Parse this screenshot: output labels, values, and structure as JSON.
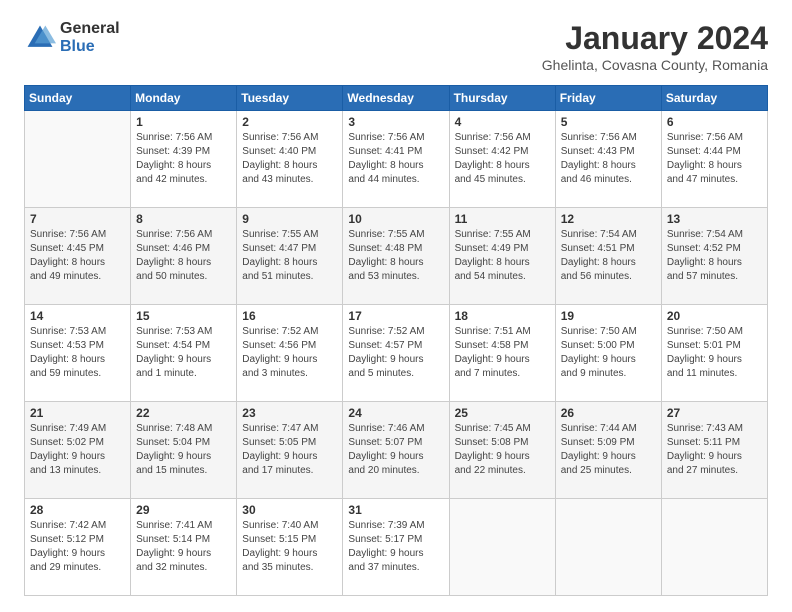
{
  "header": {
    "logo": {
      "general": "General",
      "blue": "Blue"
    },
    "title": "January 2024",
    "subtitle": "Ghelinta, Covasna County, Romania"
  },
  "weekdays": [
    "Sunday",
    "Monday",
    "Tuesday",
    "Wednesday",
    "Thursday",
    "Friday",
    "Saturday"
  ],
  "weeks": [
    [
      {
        "day": "",
        "info": ""
      },
      {
        "day": "1",
        "info": "Sunrise: 7:56 AM\nSunset: 4:39 PM\nDaylight: 8 hours\nand 42 minutes."
      },
      {
        "day": "2",
        "info": "Sunrise: 7:56 AM\nSunset: 4:40 PM\nDaylight: 8 hours\nand 43 minutes."
      },
      {
        "day": "3",
        "info": "Sunrise: 7:56 AM\nSunset: 4:41 PM\nDaylight: 8 hours\nand 44 minutes."
      },
      {
        "day": "4",
        "info": "Sunrise: 7:56 AM\nSunset: 4:42 PM\nDaylight: 8 hours\nand 45 minutes."
      },
      {
        "day": "5",
        "info": "Sunrise: 7:56 AM\nSunset: 4:43 PM\nDaylight: 8 hours\nand 46 minutes."
      },
      {
        "day": "6",
        "info": "Sunrise: 7:56 AM\nSunset: 4:44 PM\nDaylight: 8 hours\nand 47 minutes."
      }
    ],
    [
      {
        "day": "7",
        "info": "Sunrise: 7:56 AM\nSunset: 4:45 PM\nDaylight: 8 hours\nand 49 minutes."
      },
      {
        "day": "8",
        "info": "Sunrise: 7:56 AM\nSunset: 4:46 PM\nDaylight: 8 hours\nand 50 minutes."
      },
      {
        "day": "9",
        "info": "Sunrise: 7:55 AM\nSunset: 4:47 PM\nDaylight: 8 hours\nand 51 minutes."
      },
      {
        "day": "10",
        "info": "Sunrise: 7:55 AM\nSunset: 4:48 PM\nDaylight: 8 hours\nand 53 minutes."
      },
      {
        "day": "11",
        "info": "Sunrise: 7:55 AM\nSunset: 4:49 PM\nDaylight: 8 hours\nand 54 minutes."
      },
      {
        "day": "12",
        "info": "Sunrise: 7:54 AM\nSunset: 4:51 PM\nDaylight: 8 hours\nand 56 minutes."
      },
      {
        "day": "13",
        "info": "Sunrise: 7:54 AM\nSunset: 4:52 PM\nDaylight: 8 hours\nand 57 minutes."
      }
    ],
    [
      {
        "day": "14",
        "info": "Sunrise: 7:53 AM\nSunset: 4:53 PM\nDaylight: 8 hours\nand 59 minutes."
      },
      {
        "day": "15",
        "info": "Sunrise: 7:53 AM\nSunset: 4:54 PM\nDaylight: 9 hours\nand 1 minute."
      },
      {
        "day": "16",
        "info": "Sunrise: 7:52 AM\nSunset: 4:56 PM\nDaylight: 9 hours\nand 3 minutes."
      },
      {
        "day": "17",
        "info": "Sunrise: 7:52 AM\nSunset: 4:57 PM\nDaylight: 9 hours\nand 5 minutes."
      },
      {
        "day": "18",
        "info": "Sunrise: 7:51 AM\nSunset: 4:58 PM\nDaylight: 9 hours\nand 7 minutes."
      },
      {
        "day": "19",
        "info": "Sunrise: 7:50 AM\nSunset: 5:00 PM\nDaylight: 9 hours\nand 9 minutes."
      },
      {
        "day": "20",
        "info": "Sunrise: 7:50 AM\nSunset: 5:01 PM\nDaylight: 9 hours\nand 11 minutes."
      }
    ],
    [
      {
        "day": "21",
        "info": "Sunrise: 7:49 AM\nSunset: 5:02 PM\nDaylight: 9 hours\nand 13 minutes."
      },
      {
        "day": "22",
        "info": "Sunrise: 7:48 AM\nSunset: 5:04 PM\nDaylight: 9 hours\nand 15 minutes."
      },
      {
        "day": "23",
        "info": "Sunrise: 7:47 AM\nSunset: 5:05 PM\nDaylight: 9 hours\nand 17 minutes."
      },
      {
        "day": "24",
        "info": "Sunrise: 7:46 AM\nSunset: 5:07 PM\nDaylight: 9 hours\nand 20 minutes."
      },
      {
        "day": "25",
        "info": "Sunrise: 7:45 AM\nSunset: 5:08 PM\nDaylight: 9 hours\nand 22 minutes."
      },
      {
        "day": "26",
        "info": "Sunrise: 7:44 AM\nSunset: 5:09 PM\nDaylight: 9 hours\nand 25 minutes."
      },
      {
        "day": "27",
        "info": "Sunrise: 7:43 AM\nSunset: 5:11 PM\nDaylight: 9 hours\nand 27 minutes."
      }
    ],
    [
      {
        "day": "28",
        "info": "Sunrise: 7:42 AM\nSunset: 5:12 PM\nDaylight: 9 hours\nand 29 minutes."
      },
      {
        "day": "29",
        "info": "Sunrise: 7:41 AM\nSunset: 5:14 PM\nDaylight: 9 hours\nand 32 minutes."
      },
      {
        "day": "30",
        "info": "Sunrise: 7:40 AM\nSunset: 5:15 PM\nDaylight: 9 hours\nand 35 minutes."
      },
      {
        "day": "31",
        "info": "Sunrise: 7:39 AM\nSunset: 5:17 PM\nDaylight: 9 hours\nand 37 minutes."
      },
      {
        "day": "",
        "info": ""
      },
      {
        "day": "",
        "info": ""
      },
      {
        "day": "",
        "info": ""
      }
    ]
  ]
}
